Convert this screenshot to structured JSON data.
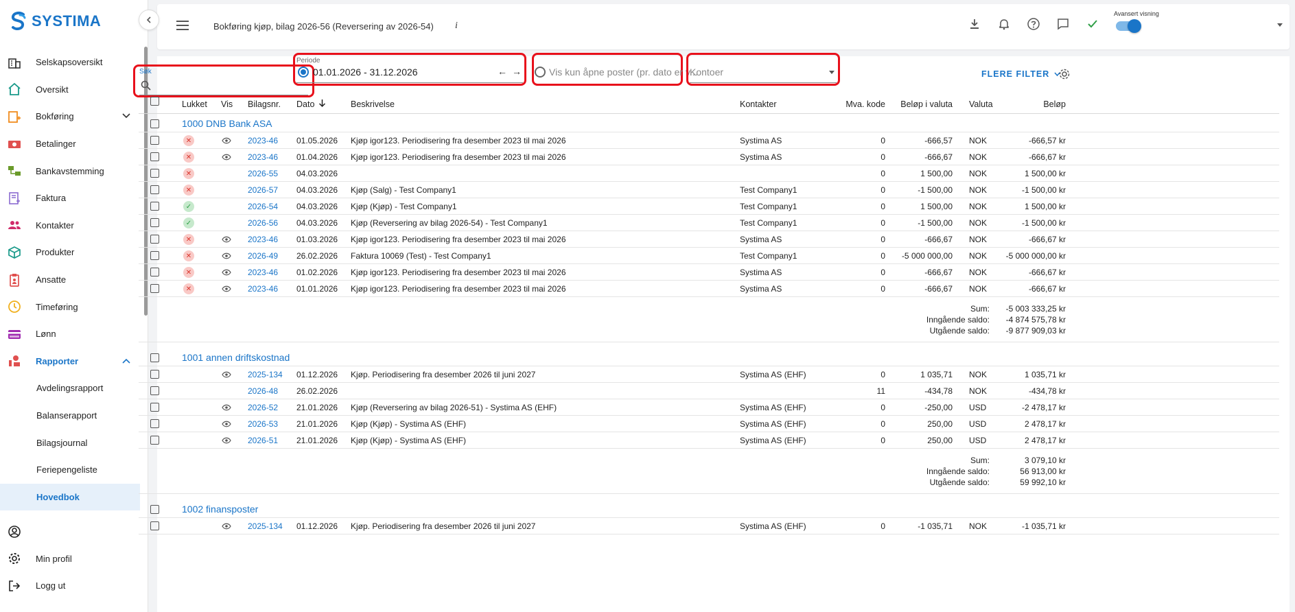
{
  "app": {
    "logo_text": "SYSTIMA"
  },
  "sidebar": {
    "items": [
      {
        "label": "Selskapsoversikt",
        "icon": "building-icon",
        "color": "#333333"
      },
      {
        "label": "Oversikt",
        "icon": "home-icon",
        "color": "#1a9a8a"
      },
      {
        "label": "Bokføring",
        "icon": "ledger-icon",
        "color": "#f08c1e",
        "expandable": true
      },
      {
        "label": "Betalinger",
        "icon": "money-icon",
        "color": "#e0504f"
      },
      {
        "label": "Bankavstemming",
        "icon": "bank-reconcile-icon",
        "color": "#6a9a2a"
      },
      {
        "label": "Faktura",
        "icon": "invoice-icon",
        "color": "#8a6ad0"
      },
      {
        "label": "Kontakter",
        "icon": "contacts-icon",
        "color": "#d02b6a"
      },
      {
        "label": "Produkter",
        "icon": "box-icon",
        "color": "#1a9a8a"
      },
      {
        "label": "Ansatte",
        "icon": "clipboard-person-icon",
        "color": "#e0504f"
      },
      {
        "label": "Timeføring",
        "icon": "clock-icon",
        "color": "#f0b01e"
      },
      {
        "label": "Lønn",
        "icon": "card-icon",
        "color": "#a02bb0"
      },
      {
        "label": "Rapporter",
        "icon": "report-icon",
        "color": "#e0504f",
        "expanded": true
      }
    ],
    "subitems": [
      "Avdelingsrapport",
      "Balanserapport",
      "Bilagsjournal",
      "Feriepengeliste",
      "Hovedbok"
    ],
    "selected_subitem": "Hovedbok",
    "bottom": [
      {
        "label": "",
        "icon": "account-circle-icon"
      },
      {
        "label": "Min profil",
        "icon": "gear-icon"
      },
      {
        "label": "Logg ut",
        "icon": "logout-icon"
      }
    ]
  },
  "header": {
    "title": "Bokføring kjøp, bilag 2026-56 (Reversering av 2026-54)",
    "info": "i",
    "advanced_view_label": "Avansert visning",
    "advanced_view_on": true
  },
  "filters": {
    "search_label": "Søk",
    "search_value": "",
    "period_label": "Periode",
    "period_value": "01.01.2026 - 31.12.2026",
    "open_items_placeholder": "Vis kun åpne poster (pr. dato er v...",
    "accounts_placeholder": "Kontoer",
    "more_filters": "FLERE FILTER"
  },
  "table": {
    "columns": [
      "Lukket",
      "Vis",
      "Bilagsnr.",
      "Dato",
      "Beskrivelse",
      "Kontakter",
      "Mva. kode",
      "Beløp i valuta",
      "Valuta",
      "Beløp"
    ],
    "groups": [
      {
        "title": "1000 DNB Bank ASA",
        "rows": [
          {
            "status": "x",
            "vis": true,
            "bilag": "2023-46",
            "dato": "01.05.2026",
            "beskrivelse": "Kjøp igor123. Periodisering fra desember 2023 til mai 2026",
            "kontakt": "Systima AS",
            "mva": "0",
            "belop_valuta": "-666,57",
            "valuta": "NOK",
            "belop": "-666,57 kr"
          },
          {
            "status": "x",
            "vis": true,
            "bilag": "2023-46",
            "dato": "01.04.2026",
            "beskrivelse": "Kjøp igor123. Periodisering fra desember 2023 til mai 2026",
            "kontakt": "Systima AS",
            "mva": "0",
            "belop_valuta": "-666,67",
            "valuta": "NOK",
            "belop": "-666,67 kr"
          },
          {
            "status": "x",
            "vis": false,
            "bilag": "2026-55",
            "dato": "04.03.2026",
            "beskrivelse": "",
            "kontakt": "",
            "mva": "0",
            "belop_valuta": "1 500,00",
            "valuta": "NOK",
            "belop": "1 500,00 kr"
          },
          {
            "status": "x",
            "vis": false,
            "bilag": "2026-57",
            "dato": "04.03.2026",
            "beskrivelse": "Kjøp (Salg) - Test Company1",
            "kontakt": "Test Company1",
            "mva": "0",
            "belop_valuta": "-1 500,00",
            "valuta": "NOK",
            "belop": "-1 500,00 kr"
          },
          {
            "status": "ok",
            "vis": false,
            "bilag": "2026-54",
            "dato": "04.03.2026",
            "beskrivelse": "Kjøp (Kjøp) - Test Company1",
            "kontakt": "Test Company1",
            "mva": "0",
            "belop_valuta": "1 500,00",
            "valuta": "NOK",
            "belop": "1 500,00 kr"
          },
          {
            "status": "ok",
            "vis": false,
            "bilag": "2026-56",
            "dato": "04.03.2026",
            "beskrivelse": "Kjøp (Reversering av bilag 2026-54) - Test Company1",
            "kontakt": "Test Company1",
            "mva": "0",
            "belop_valuta": "-1 500,00",
            "valuta": "NOK",
            "belop": "-1 500,00 kr"
          },
          {
            "status": "x",
            "vis": true,
            "bilag": "2023-46",
            "dato": "01.03.2026",
            "beskrivelse": "Kjøp igor123. Periodisering fra desember 2023 til mai 2026",
            "kontakt": "Systima AS",
            "mva": "0",
            "belop_valuta": "-666,67",
            "valuta": "NOK",
            "belop": "-666,67 kr"
          },
          {
            "status": "x",
            "vis": true,
            "bilag": "2026-49",
            "dato": "26.02.2026",
            "beskrivelse": "Faktura 10069 (Test) - Test Company1",
            "kontakt": "Test Company1",
            "mva": "0",
            "belop_valuta": "-5 000 000,00",
            "valuta": "NOK",
            "belop": "-5 000 000,00 kr"
          },
          {
            "status": "x",
            "vis": true,
            "bilag": "2023-46",
            "dato": "01.02.2026",
            "beskrivelse": "Kjøp igor123. Periodisering fra desember 2023 til mai 2026",
            "kontakt": "Systima AS",
            "mva": "0",
            "belop_valuta": "-666,67",
            "valuta": "NOK",
            "belop": "-666,67 kr"
          },
          {
            "status": "x",
            "vis": true,
            "bilag": "2023-46",
            "dato": "01.01.2026",
            "beskrivelse": "Kjøp igor123. Periodisering fra desember 2023 til mai 2026",
            "kontakt": "Systima AS",
            "mva": "0",
            "belop_valuta": "-666,67",
            "valuta": "NOK",
            "belop": "-666,67 kr"
          }
        ],
        "sum_label": "Sum:",
        "sum": "-5 003 333,25 kr",
        "opening_label": "Inngående saldo:",
        "opening": "-4 874 575,78 kr",
        "closing_label": "Utgående saldo:",
        "closing": "-9 877 909,03 kr"
      },
      {
        "title": "1001 annen driftskostnad",
        "rows": [
          {
            "status": "",
            "vis": true,
            "bilag": "2025-134",
            "dato": "01.12.2026",
            "beskrivelse": "Kjøp. Periodisering fra desember 2026 til juni 2027",
            "kontakt": "Systima AS (EHF)",
            "mva": "0",
            "belop_valuta": "1 035,71",
            "valuta": "NOK",
            "belop": "1 035,71 kr"
          },
          {
            "status": "",
            "vis": false,
            "bilag": "2026-48",
            "dato": "26.02.2026",
            "beskrivelse": "",
            "kontakt": "",
            "mva": "11",
            "belop_valuta": "-434,78",
            "valuta": "NOK",
            "belop": "-434,78 kr"
          },
          {
            "status": "",
            "vis": true,
            "bilag": "2026-52",
            "dato": "21.01.2026",
            "beskrivelse": "Kjøp (Reversering av bilag 2026-51) - Systima AS (EHF)",
            "kontakt": "Systima AS (EHF)",
            "mva": "0",
            "belop_valuta": "-250,00",
            "valuta": "USD",
            "belop": "-2 478,17 kr"
          },
          {
            "status": "",
            "vis": true,
            "bilag": "2026-53",
            "dato": "21.01.2026",
            "beskrivelse": "Kjøp (Kjøp) - Systima AS (EHF)",
            "kontakt": "Systima AS (EHF)",
            "mva": "0",
            "belop_valuta": "250,00",
            "valuta": "USD",
            "belop": "2 478,17 kr"
          },
          {
            "status": "",
            "vis": true,
            "bilag": "2026-51",
            "dato": "21.01.2026",
            "beskrivelse": "Kjøp (Kjøp) - Systima AS (EHF)",
            "kontakt": "Systima AS (EHF)",
            "mva": "0",
            "belop_valuta": "250,00",
            "valuta": "USD",
            "belop": "2 478,17 kr"
          }
        ],
        "sum_label": "Sum:",
        "sum": "3 079,10 kr",
        "opening_label": "Inngående saldo:",
        "opening": "56 913,00 kr",
        "closing_label": "Utgående saldo:",
        "closing": "59 992,10 kr"
      },
      {
        "title": "1002 finansposter",
        "rows": [
          {
            "status": "",
            "vis": true,
            "bilag": "2025-134",
            "dato": "01.12.2026",
            "beskrivelse": "Kjøp. Periodisering fra desember 2026 til juni 2027",
            "kontakt": "Systima AS (EHF)",
            "mva": "0",
            "belop_valuta": "-1 035,71",
            "valuta": "NOK",
            "belop": "-1 035,71 kr"
          }
        ]
      }
    ]
  }
}
